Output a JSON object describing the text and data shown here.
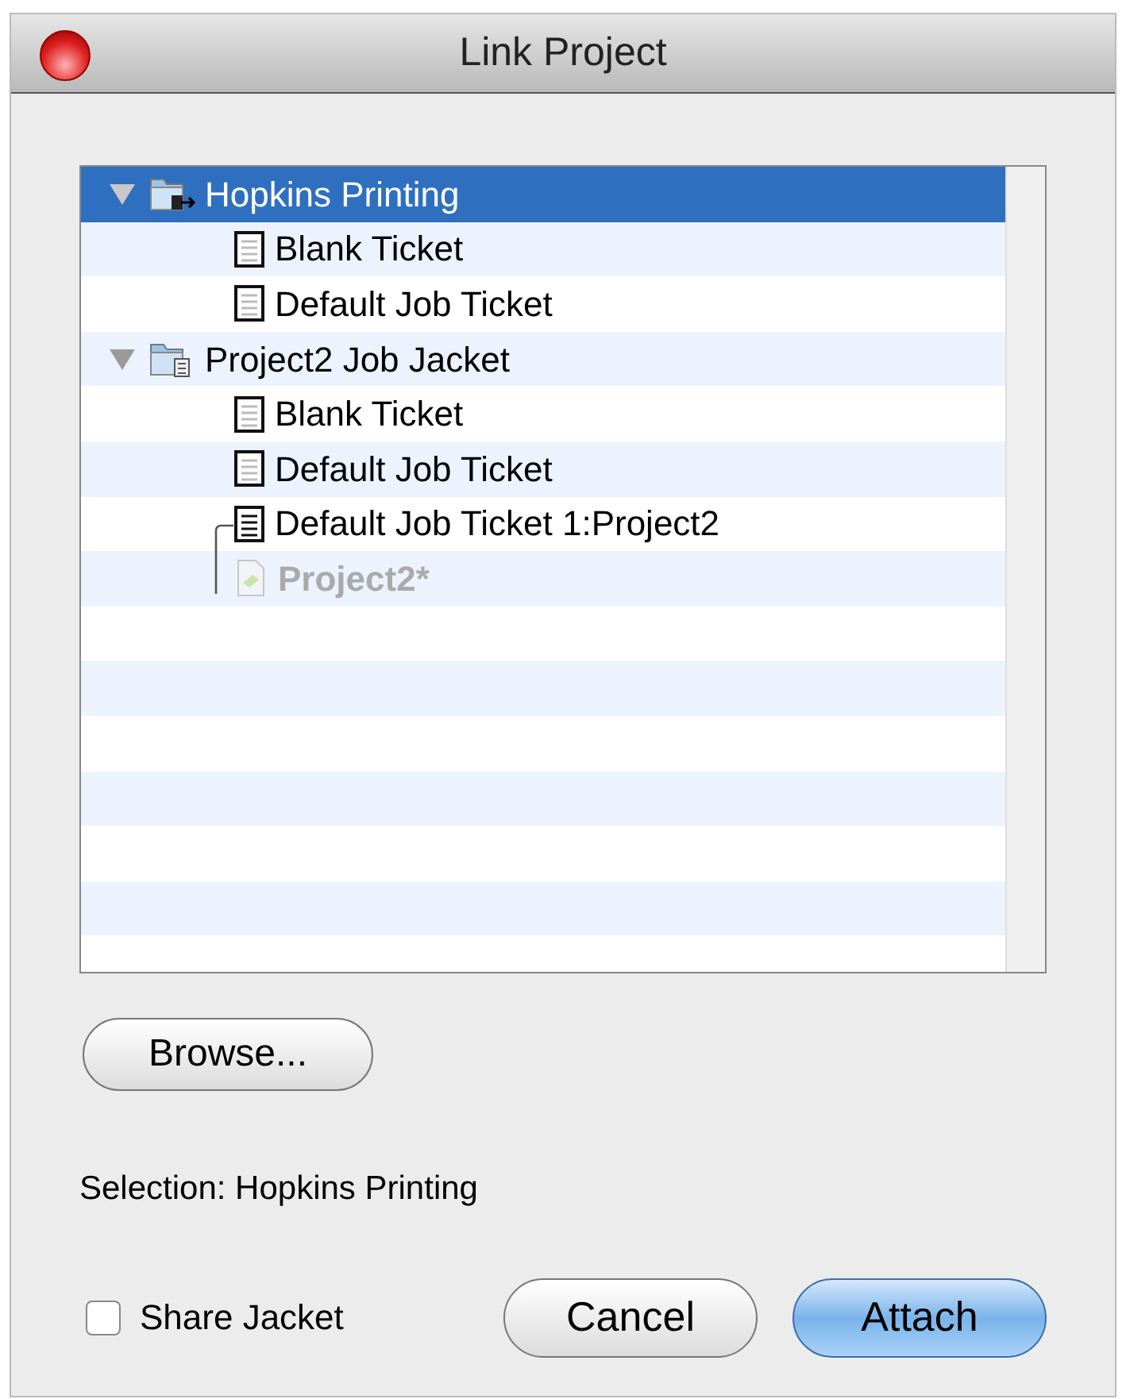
{
  "window": {
    "title": "Link Project"
  },
  "tree": [
    {
      "label": "Hopkins Printing",
      "kind": "jacket-linked",
      "selected": true,
      "expanded": true,
      "children": [
        {
          "label": "Blank Ticket",
          "kind": "ticket",
          "selected": false
        },
        {
          "label": "Default Job Ticket",
          "kind": "ticket",
          "selected": false
        }
      ]
    },
    {
      "label": "Project2 Job Jacket",
      "kind": "jacket",
      "selected": false,
      "expanded": true,
      "children": [
        {
          "label": "Blank Ticket",
          "kind": "ticket",
          "selected": false
        },
        {
          "label": "Default Job Ticket",
          "kind": "ticket",
          "selected": false
        },
        {
          "label": "Default Job Ticket 1:Project2",
          "kind": "linked-ticket",
          "selected": false
        },
        {
          "label": "Project2*",
          "kind": "project",
          "selected": false,
          "disabled": true
        }
      ]
    }
  ],
  "browse_button": "Browse...",
  "selection_text": "Selection: Hopkins Printing",
  "share_jacket": {
    "label": "Share Jacket",
    "checked": false
  },
  "buttons": [
    {
      "label": "Cancel",
      "default": false
    },
    {
      "label": "Attach",
      "default": true
    }
  ]
}
